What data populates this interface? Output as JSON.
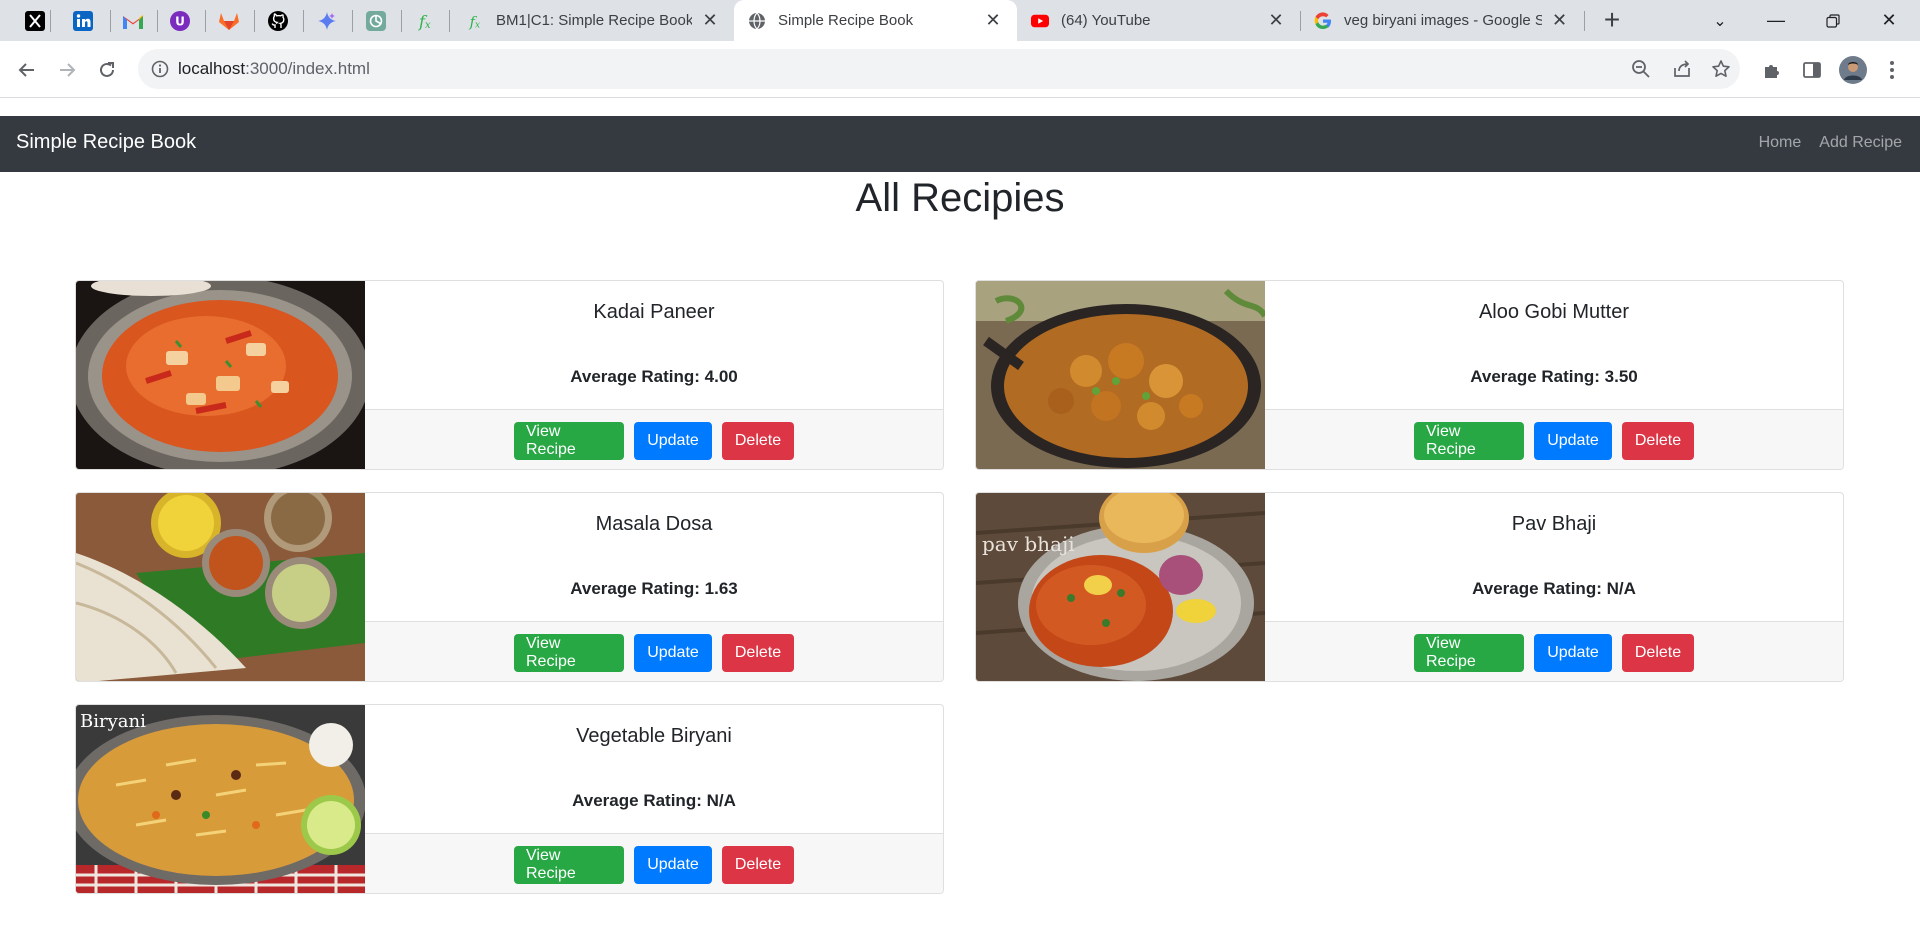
{
  "browser": {
    "pinned_tabs": [
      {
        "icon": "x-twitter-icon"
      },
      {
        "icon": "linkedin-icon"
      },
      {
        "icon": "gmail-icon"
      },
      {
        "icon": "u-extension-icon"
      },
      {
        "icon": "gitlab-icon"
      },
      {
        "icon": "github-icon"
      },
      {
        "icon": "gemini-icon"
      },
      {
        "icon": "chatgpt-icon"
      },
      {
        "icon": "fx-icon"
      }
    ],
    "tabs": [
      {
        "title": "BM1|C1: Simple Recipe Book",
        "icon": "fx-icon",
        "active": false
      },
      {
        "title": "Simple Recipe Book",
        "icon": "globe-icon",
        "active": true
      },
      {
        "title": "(64) YouTube",
        "icon": "youtube-icon",
        "active": false
      },
      {
        "title": "veg biryani images - Google Se",
        "icon": "google-icon",
        "active": false
      }
    ],
    "url_host": "localhost",
    "url_rest": ":3000/index.html"
  },
  "navbar": {
    "brand": "Simple Recipe Book",
    "links": [
      "Home",
      "Add Recipe"
    ]
  },
  "page": {
    "title": "All Recipies"
  },
  "buttons": {
    "view": "View Recipe",
    "update": "Update",
    "delete": "Delete"
  },
  "colors": {
    "navbar": "#343a40",
    "view": "#28a745",
    "update": "#007bff",
    "delete": "#dc3545"
  },
  "recipes": [
    {
      "name": "Kadai Paneer",
      "rating": "Average Rating: 4.00",
      "image": "kadai-paneer-image"
    },
    {
      "name": "Aloo Gobi Mutter",
      "rating": "Average Rating: 3.50",
      "image": "aloo-gobi-mutter-image"
    },
    {
      "name": "Masala Dosa",
      "rating": "Average Rating: 1.63",
      "image": "masala-dosa-image"
    },
    {
      "name": "Pav Bhaji",
      "rating": "Average Rating: N/A",
      "image": "pav-bhaji-image",
      "image_caption": "pav bhaji"
    },
    {
      "name": "Vegetable Biryani",
      "rating": "Average Rating: N/A",
      "image": "vegetable-biryani-image",
      "image_caption": "Biryani"
    }
  ]
}
